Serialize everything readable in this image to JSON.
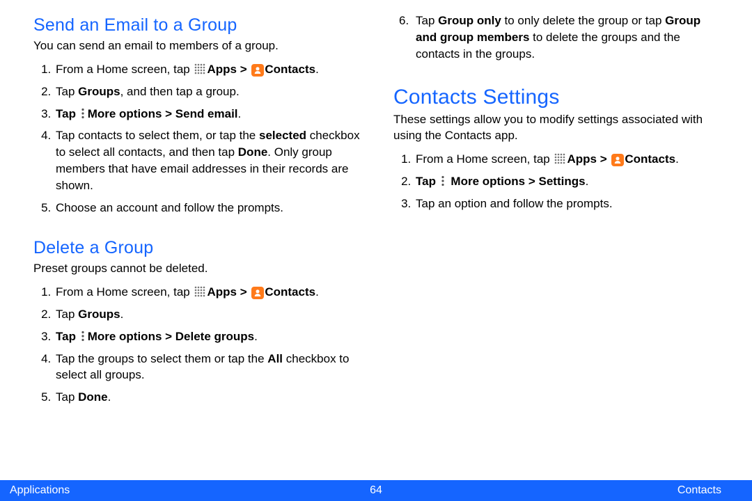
{
  "left": {
    "section1": {
      "title": "Send an Email to a Group",
      "intro": "You can send an email to members of a group.",
      "step1_a": "From a Home screen, tap ",
      "step1_apps": "Apps > ",
      "step1_contacts": "Contacts",
      "step2_a": "Tap ",
      "step2_b": "Groups",
      "step2_c": ", and then tap a group.",
      "step3_a": "Tap ",
      "step3_b": "More options > Send email",
      "step4_a": "Tap contacts to select them, or tap the ",
      "step4_b": "selected",
      "step4_c": " checkbox to select all contacts, and then tap ",
      "step4_d": "Done",
      "step4_e": ". Only group members that have email addresses in their records are shown.",
      "step5": "Choose an account and follow the prompts."
    },
    "section2": {
      "title": "Delete a Group",
      "intro": "Preset groups cannot be deleted.",
      "step1_a": "From a Home screen, tap ",
      "step1_apps": "Apps > ",
      "step1_contacts": "Contacts",
      "step2_a": "Tap ",
      "step2_b": "Groups",
      "step3_a": "Tap ",
      "step3_b": "More options > Delete groups",
      "step4_a": "Tap the groups to select them or tap the ",
      "step4_b": "All",
      "step4_c": " checkbox to select all groups.",
      "step5_a": "Tap ",
      "step5_b": "Done"
    }
  },
  "right": {
    "continued": {
      "step6_a": "Tap ",
      "step6_b": "Group only",
      "step6_c": " to only delete the group or tap ",
      "step6_d": "Group and group members",
      "step6_e": " to delete the groups and the contacts in the groups."
    },
    "section": {
      "title": "Contacts Settings",
      "intro": "These settings allow you to modify settings associated with using the Contacts app.",
      "step1_a": "From a Home screen, tap ",
      "step1_apps": "Apps > ",
      "step1_contacts": "Contacts",
      "step2_a": "Tap ",
      "step2_b": " More options > Settings",
      "step3": "Tap an option and follow the prompts."
    }
  },
  "footer": {
    "left": "Applications",
    "center": "64",
    "right": "Contacts"
  },
  "punctuation": {
    "period": "."
  }
}
